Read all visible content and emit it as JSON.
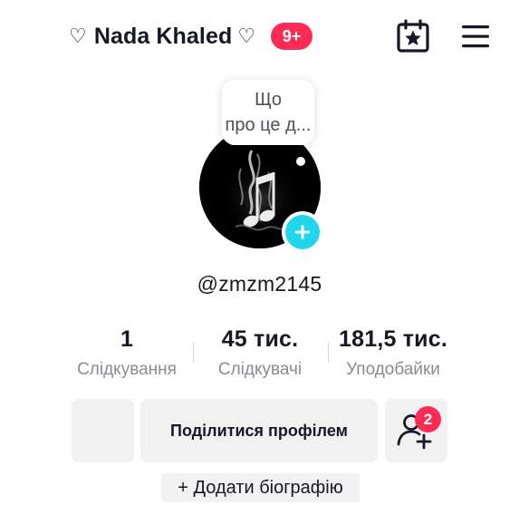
{
  "header": {
    "heart_left": "♡",
    "name": "Nada Khaled",
    "heart_right": "♡",
    "notification_count": "9+",
    "calendar_icon": "calendar-star-icon",
    "menu_icon": "hamburger-menu-icon"
  },
  "profile": {
    "bubble_line1": "Що",
    "bubble_line2": "про це д...",
    "username": "@zmzm2145",
    "add_photo_symbol": "+"
  },
  "stats": [
    {
      "value": "1",
      "label": "Слідкування"
    },
    {
      "value": "45 тис.",
      "label": "Слідкувачі"
    },
    {
      "value": "181,5 тис.",
      "label": "Уподобайки"
    }
  ],
  "actions": {
    "share_label": "Поділитися профілем",
    "add_friend_badge": "2",
    "add_bio_label": "+ Додати біографію"
  },
  "colors": {
    "accent": "#fe2c55",
    "add_button": "#20d5ec",
    "button_bg": "#f1f1f2",
    "secondary_text": "#8a8b91"
  }
}
